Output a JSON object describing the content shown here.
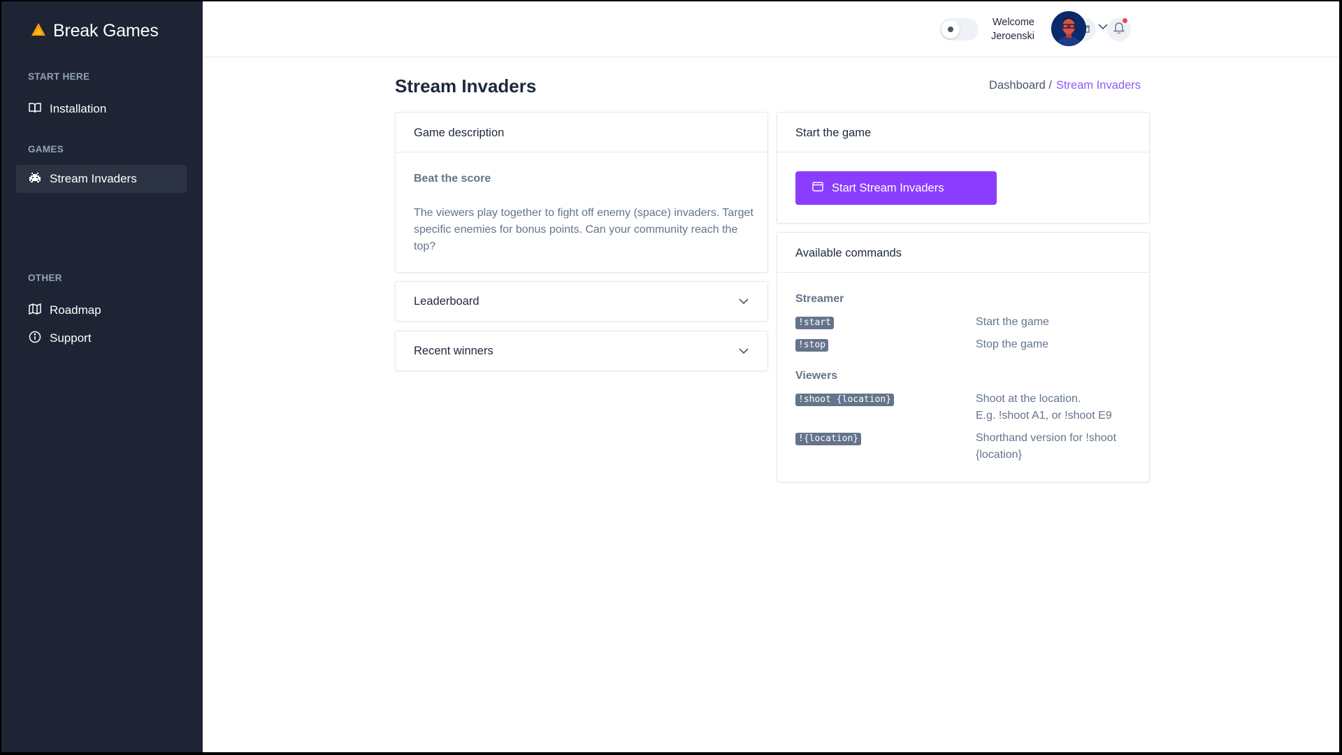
{
  "brand": {
    "name": "Break Games",
    "logo_color": "#f59e0b"
  },
  "sidebar": {
    "sections": [
      {
        "label": "START HERE",
        "items": [
          {
            "label": "Installation",
            "icon": "book-icon"
          }
        ]
      },
      {
        "label": "GAMES",
        "items": [
          {
            "label": "Stream Invaders",
            "icon": "space-invader-icon",
            "active": true
          }
        ]
      },
      {
        "label": "OTHER",
        "items": [
          {
            "label": "Roadmap",
            "icon": "map-icon"
          },
          {
            "label": "Support",
            "icon": "info-circle-icon"
          }
        ]
      }
    ]
  },
  "topbar": {
    "welcome_line1": "Welcome",
    "welcome_line2": "Jeroenski",
    "icons": [
      "folder-icon",
      "bell-icon",
      "theme-toggle",
      "chevron-down-icon"
    ]
  },
  "page": {
    "title": "Stream Invaders",
    "breadcrumb": {
      "parent": "Dashboard /",
      "current": "Stream Invaders"
    }
  },
  "description_card": {
    "header": "Game description",
    "subtitle": "Beat the score",
    "text": "The viewers play together to fight off enemy (space) invaders. Target specific enemies for bonus points. Can your community reach the top?"
  },
  "leaderboard_card": {
    "header": "Leaderboard"
  },
  "winners_card": {
    "header": "Recent winners"
  },
  "start_card": {
    "header": "Start the game",
    "button_label": "Start Stream Invaders"
  },
  "commands_card": {
    "header": "Available commands",
    "streamer": {
      "label": "Streamer",
      "commands": [
        {
          "code": "!start",
          "desc": "Start the game"
        },
        {
          "code": "!stop",
          "desc": "Stop the game"
        }
      ]
    },
    "viewers": {
      "label": "Viewers",
      "commands": [
        {
          "code": "!shoot {location}",
          "desc_line1": "Shoot at the location.",
          "desc_line2": "E.g. !shoot A1, or !shoot E9"
        },
        {
          "code": "!{location}",
          "desc_line1": "Shorthand version for !shoot",
          "desc_line2": "{location}"
        }
      ]
    }
  },
  "colors": {
    "accent": "#8b3dff",
    "sidebar_bg": "#1e2433",
    "breadcrumb_active": "#8b5cf6"
  }
}
